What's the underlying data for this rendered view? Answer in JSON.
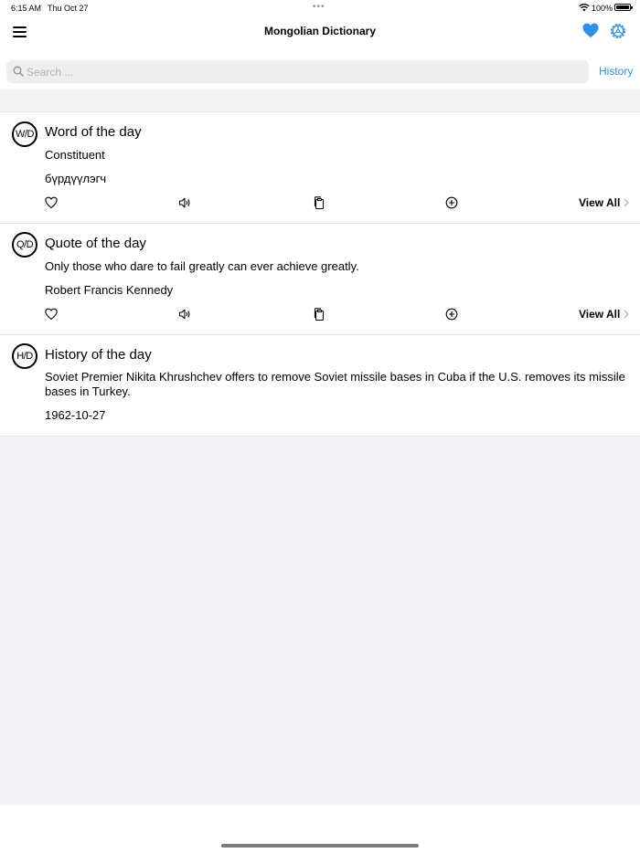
{
  "status": {
    "time": "6:15 AM",
    "date": "Thu Oct 27",
    "dots": "•••",
    "battery_percent": "100%",
    "battery_level": 1.0
  },
  "nav": {
    "title": "Mongolian Dictionary"
  },
  "search": {
    "placeholder": "Search ...",
    "value": "",
    "history_label": "History"
  },
  "cards": {
    "word": {
      "badge": "W/D",
      "title": "Word of the day",
      "line1": "Constituent",
      "line2": "бүрдүүлэгч",
      "view_all": "View All"
    },
    "quote": {
      "badge": "Q/D",
      "title": "Quote of the day",
      "line1": "Only those who dare to fail greatly can ever achieve greatly.",
      "line2": "Robert Francis Kennedy",
      "view_all": "View All"
    },
    "history": {
      "badge": "H/D",
      "title": "History of the day",
      "line1": "Soviet Premier Nikita Khrushchev offers to remove Soviet missile bases in Cuba if the U.S. removes its missile bases in Turkey.",
      "line2": "1962-10-27"
    }
  },
  "colors": {
    "accent": "#2f8ee6",
    "background_gray": "#f2f2f4"
  },
  "icons": [
    "menu-icon",
    "heart-icon",
    "settings-icon",
    "search-icon",
    "favorite-icon",
    "speaker-icon",
    "copy-icon",
    "add-icon",
    "chevron-right-icon"
  ]
}
